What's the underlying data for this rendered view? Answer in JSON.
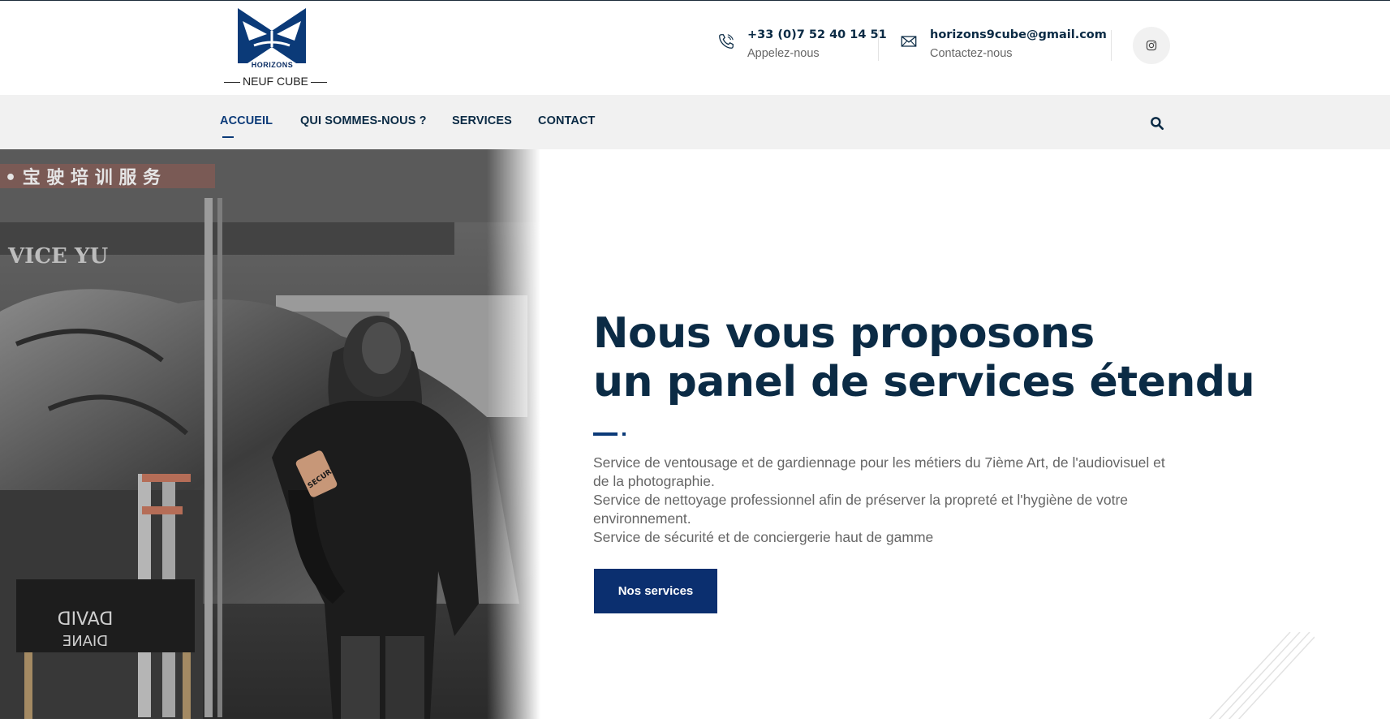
{
  "brand": {
    "logo_text_top": "HORIZONS",
    "logo_text_bottom": "NEUF CUBE",
    "logo_icon": "butterfly-cube-logo",
    "accent_color": "#0b2f6f",
    "dark_color": "#0b2b45"
  },
  "header": {
    "phone": {
      "number": "+33 (0)7 52 40 14 51",
      "label": "Appelez-nous",
      "icon": "phone-icon"
    },
    "email": {
      "address": "horizons9cube@gmail.com",
      "label": "Contactez-nous",
      "icon": "envelope-icon"
    },
    "social": {
      "icon": "instagram-icon"
    }
  },
  "nav": {
    "items": [
      {
        "label": "ACCUEIL",
        "active": true
      },
      {
        "label": "QUI SOMMES-NOUS ?",
        "active": false
      },
      {
        "label": "SERVICES",
        "active": false
      },
      {
        "label": "CONTACT",
        "active": false
      }
    ],
    "search_icon": "search-icon"
  },
  "hero": {
    "title_line1": "Nous vous proposons",
    "title_line2": "un panel de services étendu",
    "desc_line1": "Service de ventousage et de gardiennage pour les métiers du 7ième Art, de l'audiovisuel et de la photographie.",
    "desc_line2": "Service de nettoyage professionnel afin de préserver la propreté et l'hygiène de votre environnement.",
    "desc_line3": "Service de sécurité et de conciergerie haut de gamme",
    "cta_label": "Nos services",
    "photo": {
      "sign_text": "DAVID",
      "sign_text_2": "DIANE",
      "armband_text": "SECURI",
      "banner_text": "VICE YU"
    }
  }
}
